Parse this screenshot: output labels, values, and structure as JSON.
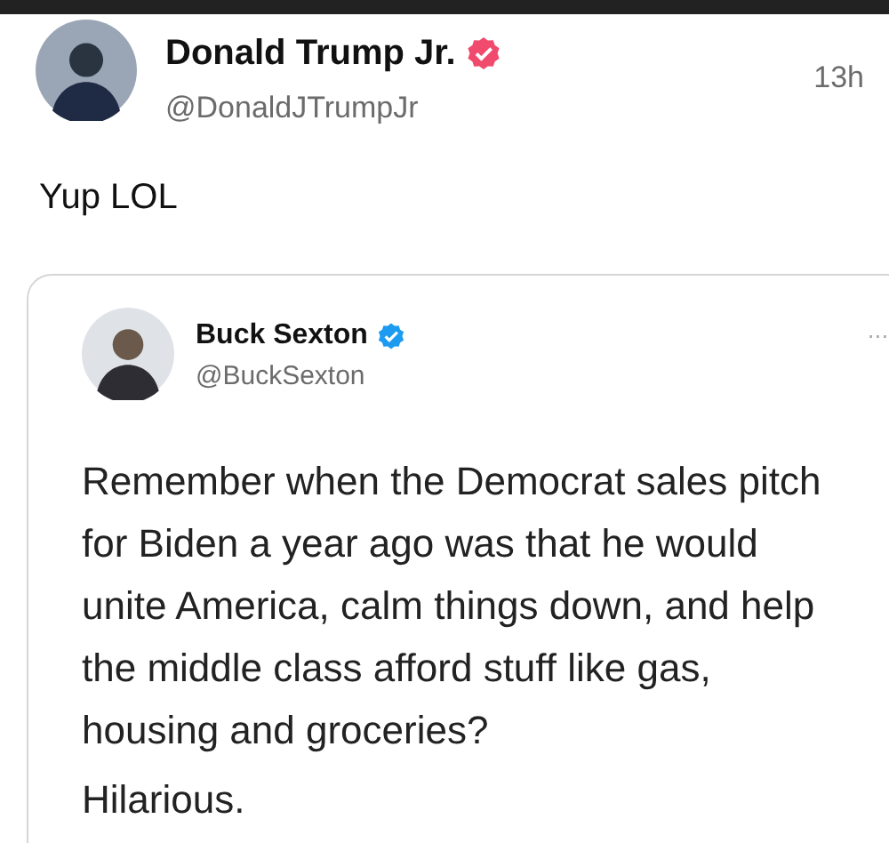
{
  "post": {
    "author": {
      "name": "Donald Trump Jr.",
      "handle": "@DonaldJTrumpJr",
      "verified": true
    },
    "time": "13h",
    "text": "Yup LOL"
  },
  "quoted_post": {
    "author": {
      "name": "Buck Sexton",
      "handle": "@BuckSexton",
      "verified": true
    },
    "menu": "...",
    "paragraphs": [
      "Remember when the Democrat sales pitch for Biden a year ago was that he would unite America, calm things down, and help the middle class afford stuff like gas, housing and groceries?",
      "Hilarious."
    ]
  }
}
